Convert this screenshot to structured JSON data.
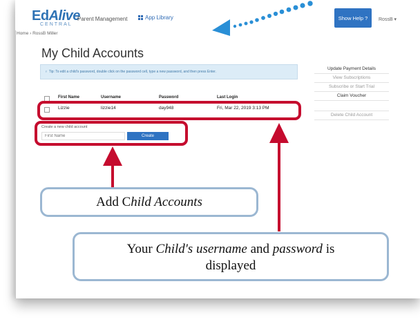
{
  "header": {
    "logo_main_ed": "Ed",
    "logo_main_alive": "Alive",
    "logo_sub": "CENTRAL",
    "parent_management": "Parent Management",
    "app_library": "App Library",
    "show_help": "Show Help ?",
    "user_menu": "RossB ▾"
  },
  "breadcrumb": "Home › RossB Miller",
  "page_title": "My Child Accounts",
  "tip": "Tip: To edit a child's password, double click on the password cell, type a new password, and then press Enter.",
  "table": {
    "headers": [
      "First Name",
      "Username",
      "Password",
      "Last Login"
    ],
    "rows": [
      [
        "Lizzie",
        "lizzie14",
        "day948",
        "Fri, Mar 22, 2019 3:13 PM"
      ]
    ]
  },
  "create": {
    "label": "Create a new child account",
    "placeholder": "First Name",
    "button": "Create"
  },
  "sidebar": {
    "items": [
      "Update Payment Details",
      "View Subscriptions",
      "Subscribe or Start Trial",
      "Claim Voucher",
      "Delete Child Account"
    ]
  },
  "callouts": {
    "add_prefix": "Add C",
    "add_italic": "hild Accounts",
    "user_prefix": "Your ",
    "user_italic1": "Child's username",
    "user_mid": " and ",
    "user_italic2": "password",
    "user_suffix": " is",
    "user_line2": "displayed"
  },
  "colors": {
    "annotation_red": "#c50b2e",
    "callout_border": "#9bb7d2",
    "brand_blue": "#2f73c2",
    "arrow_dots": "#2a8fd6"
  }
}
